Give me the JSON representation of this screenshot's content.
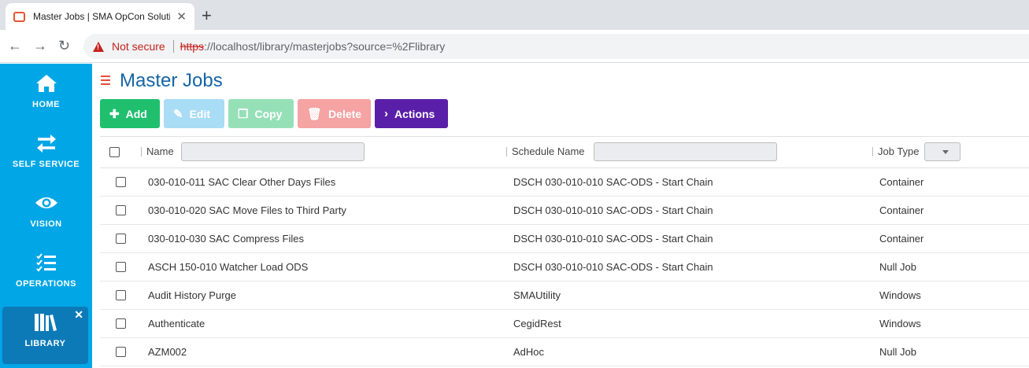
{
  "browser": {
    "tab_title": "Master Jobs | SMA OpCon Solutio",
    "tab_close": "✕",
    "new_tab": "+",
    "security_label": "Not secure",
    "url_scheme": "https",
    "url_rest": "://localhost/library/masterjobs?source=%2Flibrary"
  },
  "sidebar": {
    "items": [
      {
        "label": "HOME",
        "icon": "home-icon"
      },
      {
        "label": "SELF SERVICE",
        "icon": "swap-arrows-icon"
      },
      {
        "label": "VISION",
        "icon": "eye-icon"
      },
      {
        "label": "OPERATIONS",
        "icon": "checklist-icon"
      },
      {
        "label": "LIBRARY",
        "icon": "books-icon",
        "active": true
      }
    ],
    "close_glyph": "✕"
  },
  "page": {
    "title": "Master Jobs"
  },
  "toolbar": {
    "add": "Add",
    "edit": "Edit",
    "copy": "Copy",
    "delete": "Delete",
    "actions": "Actions"
  },
  "grid": {
    "columns": [
      "Name",
      "Schedule Name",
      "Job Type"
    ],
    "rows": [
      {
        "name": "030-010-011 SAC Clear Other Days Files",
        "schedule": "DSCH 030-010-010 SAC-ODS - Start Chain",
        "type": "Container"
      },
      {
        "name": "030-010-020 SAC Move Files to Third Party",
        "schedule": "DSCH 030-010-010 SAC-ODS - Start Chain",
        "type": "Container"
      },
      {
        "name": "030-010-030 SAC Compress Files",
        "schedule": "DSCH 030-010-010 SAC-ODS - Start Chain",
        "type": "Container"
      },
      {
        "name": "ASCH 150-010 Watcher Load ODS",
        "schedule": "DSCH 030-010-010 SAC-ODS - Start Chain",
        "type": "Null Job"
      },
      {
        "name": "Audit History Purge",
        "schedule": "SMAUtility",
        "type": "Windows"
      },
      {
        "name": "Authenticate",
        "schedule": "CegidRest",
        "type": "Windows"
      },
      {
        "name": "AZM002",
        "schedule": "AdHoc",
        "type": "Null Job"
      }
    ]
  },
  "colors": {
    "sidebar": "#00a6e6",
    "sidebar_active": "#0d7ab8",
    "title": "#1565a6",
    "add": "#1fbf6e",
    "actions": "#5a1fa8"
  }
}
